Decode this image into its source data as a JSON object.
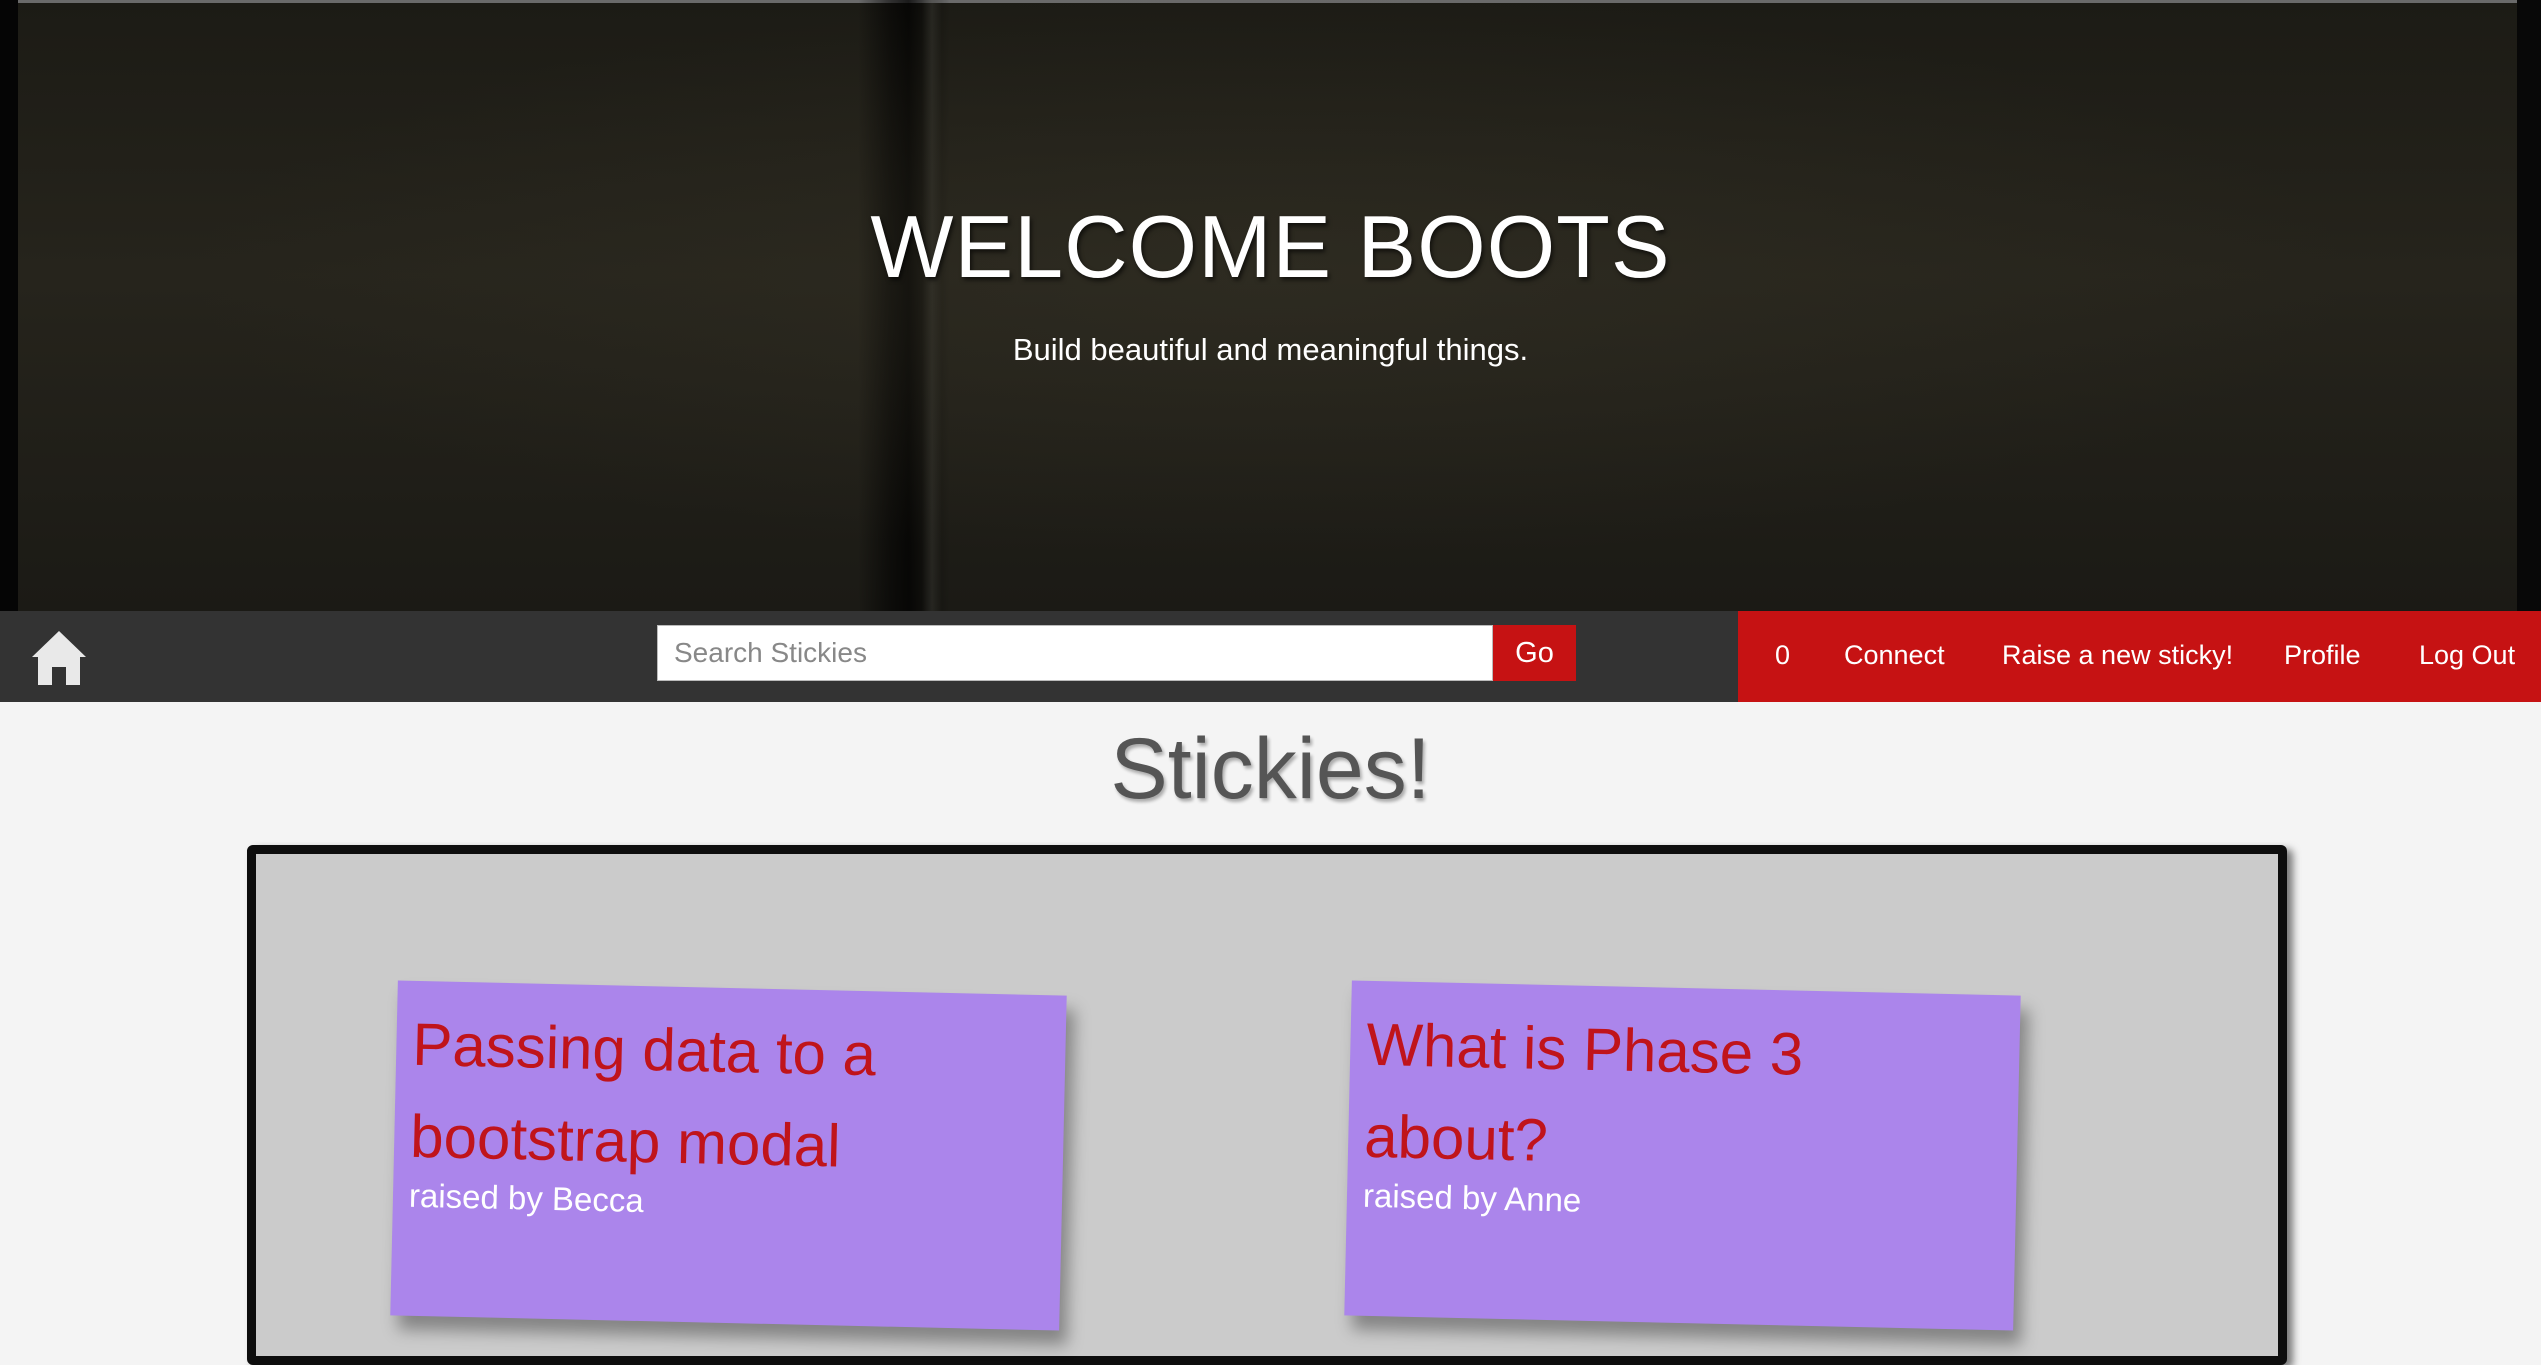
{
  "hero": {
    "title": "WELCOME BOOTS",
    "subtitle": "Build beautiful and meaningful things."
  },
  "navbar": {
    "home_icon": "home-icon",
    "search": {
      "placeholder": "Search Stickies",
      "value": ""
    },
    "go_label": "Go",
    "links": {
      "count": "0",
      "connect": "Connect",
      "raise": "Raise a new sticky!",
      "profile": "Profile",
      "logout": "Log Out"
    },
    "colors": {
      "bar": "#333333",
      "accent": "#c61213"
    }
  },
  "main": {
    "title": "Stickies!",
    "stickies": [
      {
        "title": "Passing data to a bootstrap modal",
        "raised_by": "raised by Becca"
      },
      {
        "title": "What is Phase 3 about?",
        "raised_by": "raised by Anne"
      }
    ],
    "colors": {
      "sticky": "#ab85eb",
      "sticky_title": "#c0141b",
      "board": "#cbcbcb"
    }
  }
}
